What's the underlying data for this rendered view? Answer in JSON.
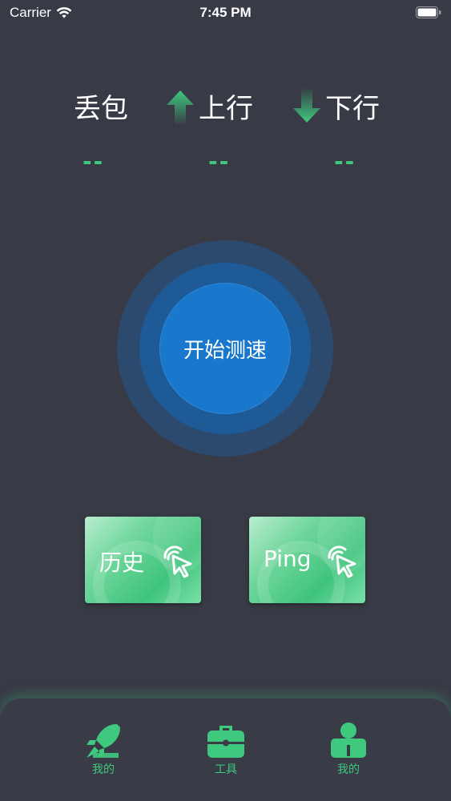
{
  "status_bar": {
    "carrier": "Carrier",
    "time": "7:45 PM"
  },
  "stats": {
    "packet_loss_label": "丢包",
    "upload_label": "上行",
    "download_label": "下行",
    "packet_loss_value": "--",
    "upload_value": "--",
    "download_value": "--"
  },
  "start_button": {
    "label": "开始测速"
  },
  "cards": {
    "history_label": "历史",
    "ping_label": "Ping"
  },
  "tab_bar": {
    "items": [
      {
        "label": "我的",
        "icon": "rocket-icon"
      },
      {
        "label": "工具",
        "icon": "toolbox-icon"
      },
      {
        "label": "我的",
        "icon": "user-icon"
      }
    ]
  },
  "colors": {
    "background": "#383a45",
    "accent_green": "#3fc97e",
    "button_blue": "#1a78cc"
  }
}
